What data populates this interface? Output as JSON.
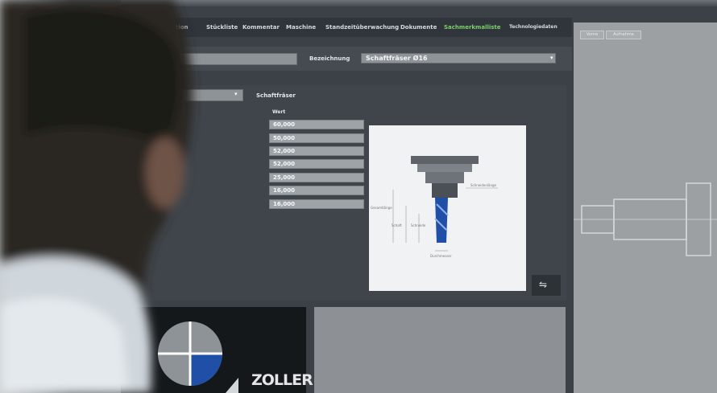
{
  "menu": {
    "items": [
      "tion",
      "Stückliste",
      "Kommentar",
      "Maschine",
      "Standzeitüberwachung",
      "Dokumente",
      "Sachmerkmalliste",
      "Technologiedaten"
    ],
    "active_index": 6
  },
  "form": {
    "bezeichnung_label": "Bezeichnung",
    "bezeichnung_value": "Schaftfräser Ø16",
    "type_label": "Schaftfräser"
  },
  "table": {
    "header": "Wert",
    "values": [
      "60,000",
      "50,000",
      "52,000",
      "52,000",
      "25,000",
      "16,000",
      "16,000"
    ]
  },
  "preview": {
    "labels": [
      "Gesamtlänge",
      "Schaft",
      "Schneide",
      "Schneidenlänge",
      "Durchmesser"
    ]
  },
  "sidebar": {
    "tabs": [
      "Vorne",
      "Aufnahme"
    ]
  },
  "brand": {
    "logo": "ZOLLER"
  },
  "colors": {
    "active_menu": "#7ccf6a",
    "tool_blue": "#1f4fa6"
  }
}
